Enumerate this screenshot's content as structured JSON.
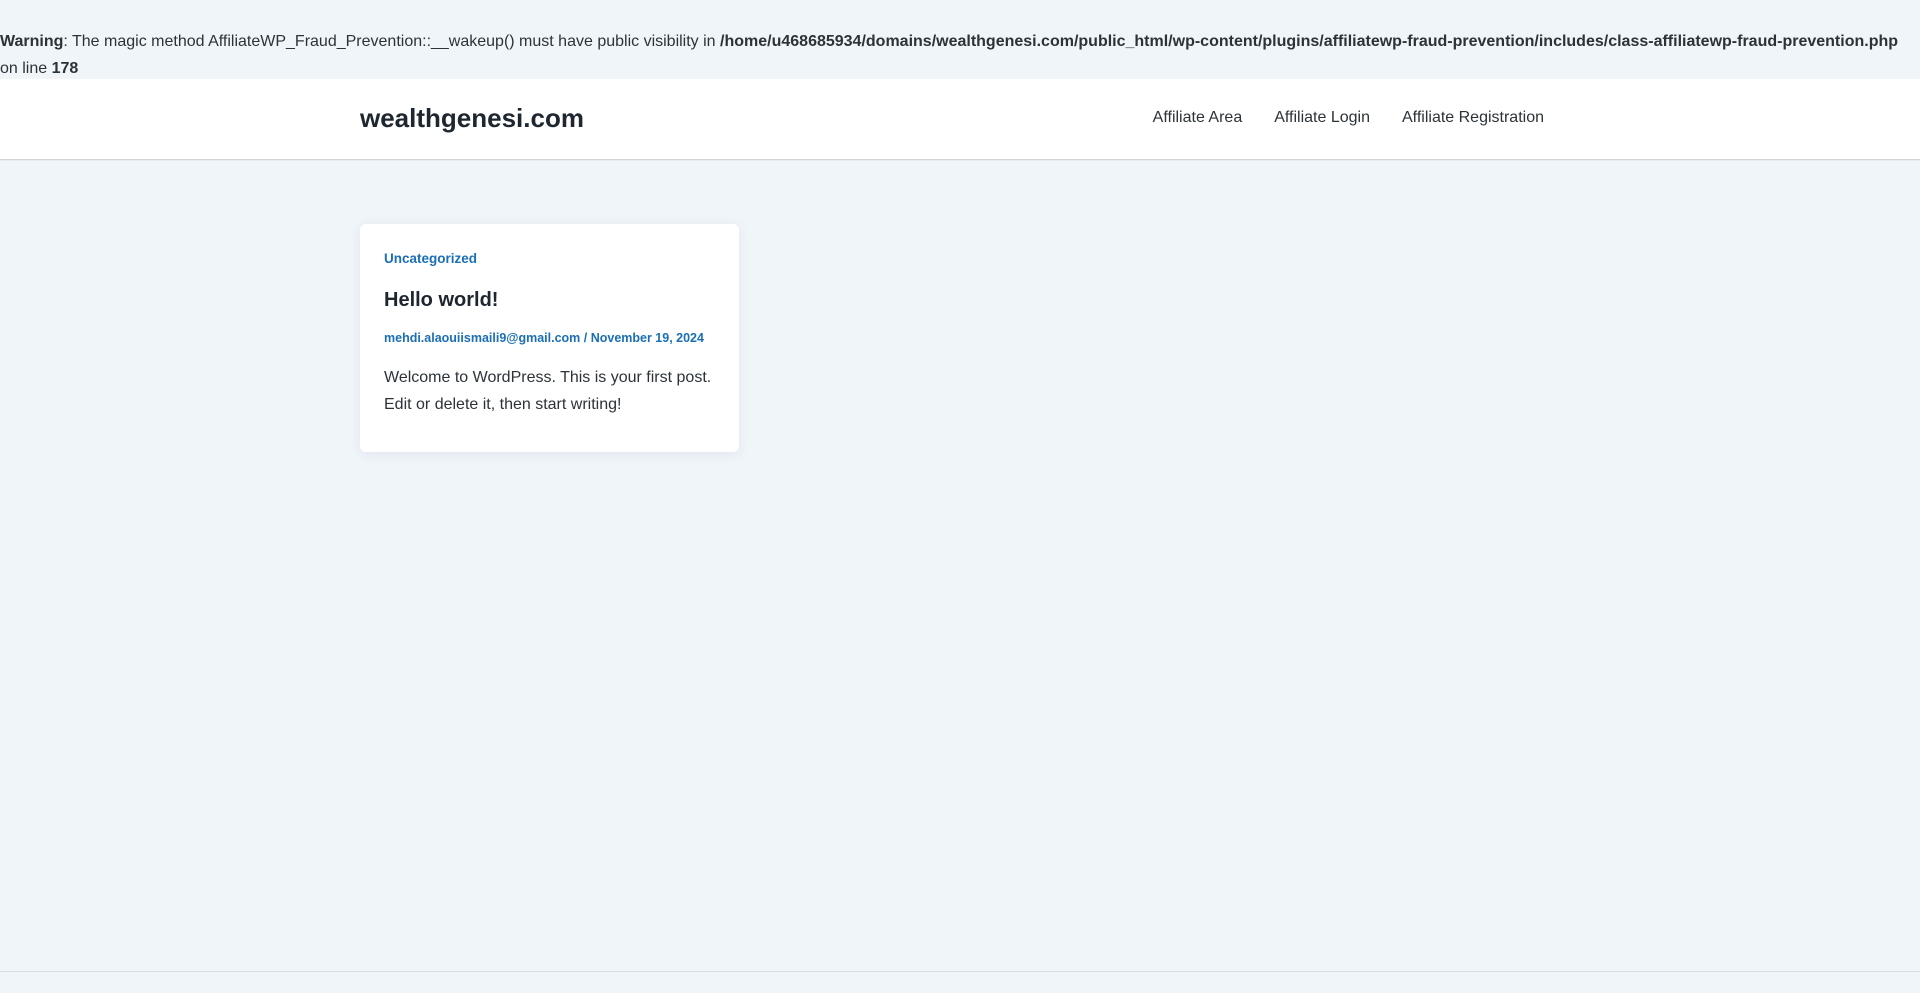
{
  "warning": {
    "label": "Warning",
    "message": ": The magic method AffiliateWP_Fraud_Prevention::__wakeup() must have public visibility in ",
    "path": "/home/u468685934/domains/wealthgenesi.com/public_html/wp-content/plugins/affiliatewp-fraud-prevention/includes/class-affiliatewp-fraud-prevention.php",
    "line_prefix": "on line ",
    "line_number": "178"
  },
  "header": {
    "site_title": "wealthgenesi.com",
    "nav": {
      "affiliate_area": "Affiliate Area",
      "affiliate_login": "Affiliate Login",
      "affiliate_registration": "Affiliate Registration"
    }
  },
  "post": {
    "category": "Uncategorized",
    "title": "Hello world!",
    "author": "mehdi.alaouiismaili9@gmail.com",
    "separator": " / ",
    "date": "November 19, 2024",
    "excerpt": "Welcome to WordPress. This is your first post. Edit or delete it, then start writing!"
  },
  "colors": {
    "background": "#f0f5fa",
    "link": "#1a6fb5",
    "heading": "#1e2630"
  }
}
